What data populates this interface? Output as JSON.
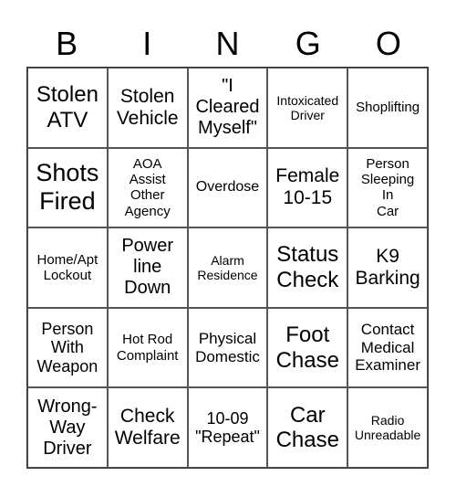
{
  "header": [
    "B",
    "I",
    "N",
    "G",
    "O"
  ],
  "cells": [
    {
      "text": "Stolen\nATV",
      "size": 24
    },
    {
      "text": "Stolen\nVehicle",
      "size": 21
    },
    {
      "text": "\"I\nCleared\nMyself\"",
      "size": 20
    },
    {
      "text": "Intoxicated\nDriver",
      "size": 14
    },
    {
      "text": "Shoplifting",
      "size": 15
    },
    {
      "text": "Shots\nFired",
      "size": 27
    },
    {
      "text": "AOA\nAssist\nOther\nAgency",
      "size": 15
    },
    {
      "text": "Overdose",
      "size": 16
    },
    {
      "text": "Female\n10-15",
      "size": 21
    },
    {
      "text": "Person\nSleeping\nIn\nCar",
      "size": 15
    },
    {
      "text": "Home/Apt\nLockout",
      "size": 15
    },
    {
      "text": "Power\nline\nDown",
      "size": 20
    },
    {
      "text": "Alarm\nResidence",
      "size": 14
    },
    {
      "text": "Status\nCheck",
      "size": 24
    },
    {
      "text": "K9\nBarking",
      "size": 21
    },
    {
      "text": "Person\nWith\nWeapon",
      "size": 18
    },
    {
      "text": "Hot Rod\nComplaint",
      "size": 15
    },
    {
      "text": "Physical\nDomestic",
      "size": 17
    },
    {
      "text": "Foot\nChase",
      "size": 24
    },
    {
      "text": "Contact\nMedical\nExaminer",
      "size": 17
    },
    {
      "text": "Wrong-\nWay\nDriver",
      "size": 20
    },
    {
      "text": "Check\nWelfare",
      "size": 21
    },
    {
      "text": "10-09\n\"Repeat\"",
      "size": 18
    },
    {
      "text": "Car\nChase",
      "size": 24
    },
    {
      "text": "Radio\nUnreadable",
      "size": 14
    }
  ]
}
